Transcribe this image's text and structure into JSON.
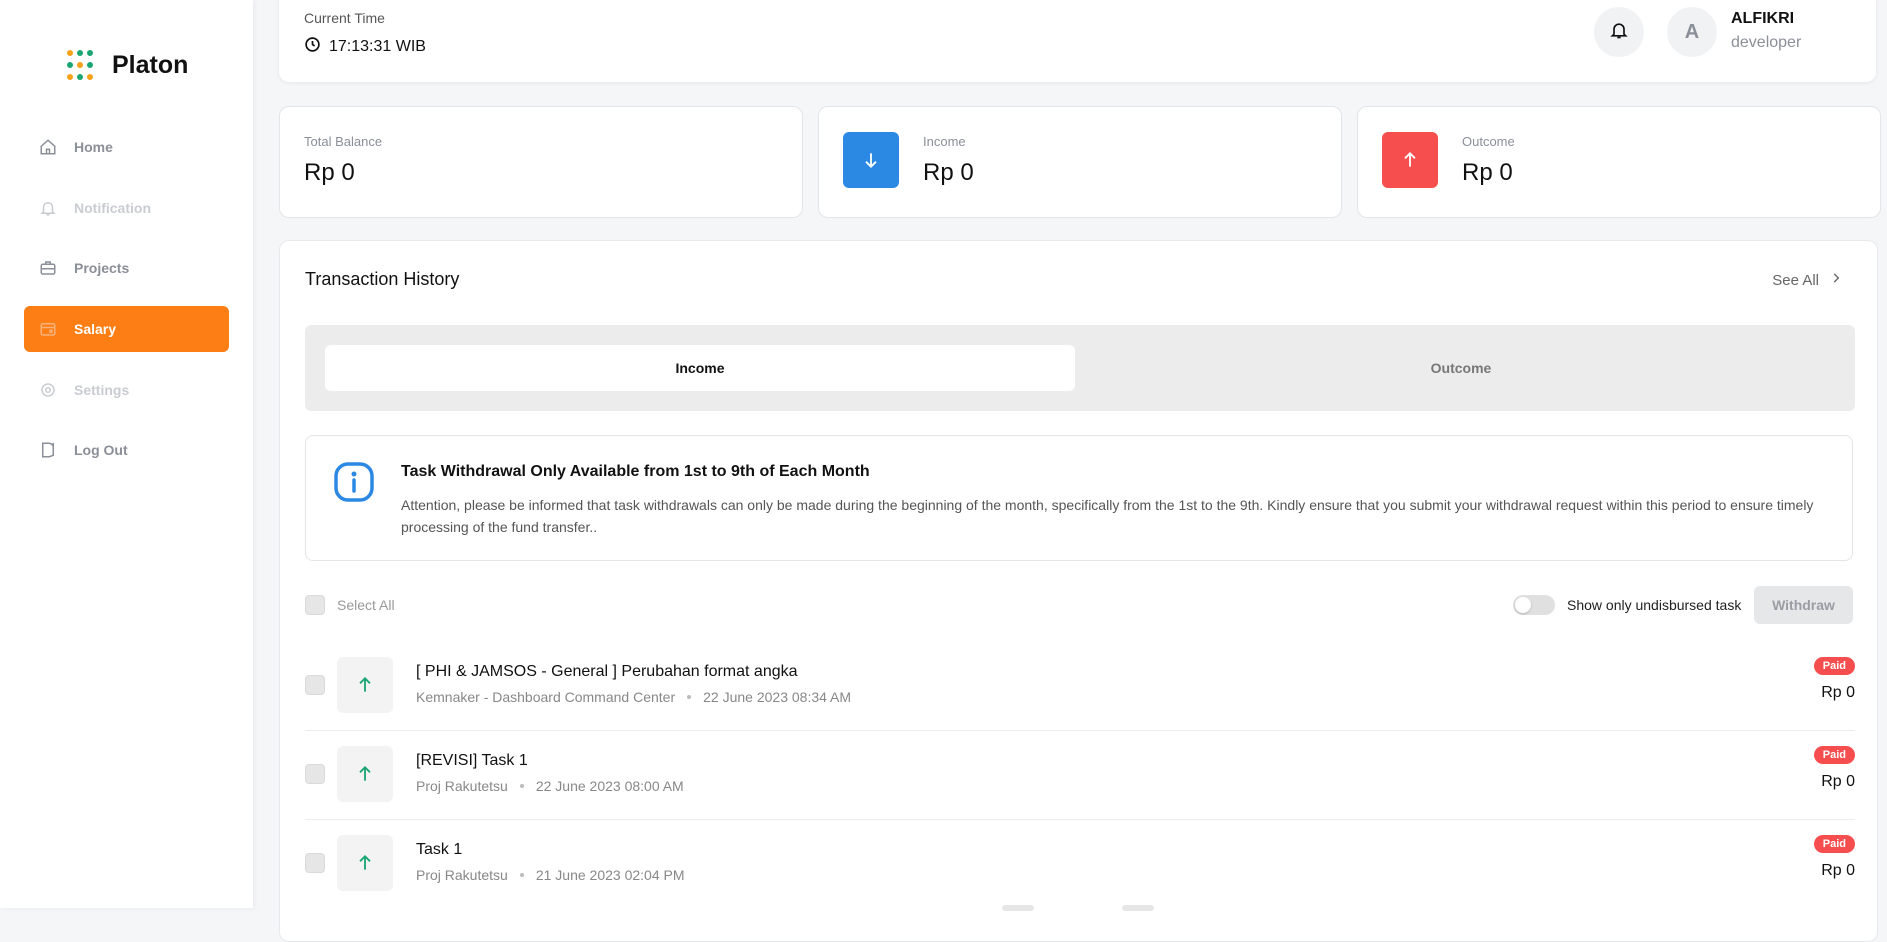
{
  "brand": {
    "name": "Platon"
  },
  "sidebar": {
    "items": [
      {
        "label": "Home",
        "icon": "home-icon",
        "state": "normal"
      },
      {
        "label": "Notification",
        "icon": "bell-icon",
        "state": "disabled"
      },
      {
        "label": "Projects",
        "icon": "briefcase-icon",
        "state": "normal"
      },
      {
        "label": "Salary",
        "icon": "wallet-icon",
        "state": "active"
      },
      {
        "label": "Settings",
        "icon": "gear-icon",
        "state": "disabled"
      },
      {
        "label": "Log Out",
        "icon": "logout-icon",
        "state": "normal"
      }
    ]
  },
  "header": {
    "time_label": "Current Time",
    "time_value": "17:13:31 WIB",
    "user_initial": "A",
    "user_name": "ALFIKRI",
    "user_role": "developer"
  },
  "stats": {
    "total_balance": {
      "label": "Total Balance",
      "value": "Rp 0"
    },
    "income": {
      "label": "Income",
      "value": "Rp 0",
      "color": "#2b88e3",
      "icon": "arrow-down-icon"
    },
    "outcome": {
      "label": "Outcome",
      "value": "Rp 0",
      "color": "#f64e4e",
      "icon": "arrow-up-icon"
    }
  },
  "history": {
    "title": "Transaction History",
    "see_all": "See All",
    "tabs": {
      "income": "Income",
      "outcome": "Outcome",
      "active": "Income"
    },
    "alert": {
      "title": "Task Withdrawal Only Available from 1st to 9th of Each Month",
      "text": "Attention, please be informed that task withdrawals can only be made during the beginning of the month, specifically from the 1st to the 9th. Kindly ensure that you submit your withdrawal request within this period to ensure timely processing of the fund transfer.."
    },
    "select_all": "Select All",
    "toggle_label": "Show only undisbursed task",
    "withdraw": "Withdraw",
    "rows": [
      {
        "title": "[ PHI & JAMSOS - General ] Perubahan format angka",
        "project": "Kemnaker - Dashboard Command Center",
        "date": "22 June 2023 08:34 AM",
        "status": "Paid",
        "amount": "Rp 0"
      },
      {
        "title": "[REVISI] Task 1",
        "project": "Proj Rakutetsu",
        "date": "22 June 2023 08:00 AM",
        "status": "Paid",
        "amount": "Rp 0"
      },
      {
        "title": "Task 1",
        "project": "Proj Rakutetsu",
        "date": "21 June 2023 02:04 PM",
        "status": "Paid",
        "amount": "Rp 0"
      }
    ]
  },
  "colors": {
    "accent": "#fd7e14",
    "income": "#2b88e3",
    "outcome": "#f64e4e",
    "paid": "#f64e4e",
    "up_arrow": "#1aa672"
  }
}
